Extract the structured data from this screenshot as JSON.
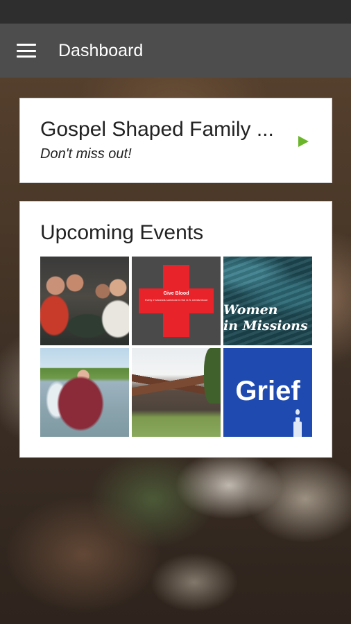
{
  "appbar": {
    "title": "Dashboard",
    "menu_icon": "hamburger-menu-icon"
  },
  "promo_card": {
    "title": "Gospel Shaped Family ...",
    "subtitle": "Don't miss out!",
    "play_icon": "play-icon",
    "play_color": "#6bb52b"
  },
  "events_card": {
    "title": "Upcoming Events",
    "tiles": [
      {
        "name": "event-tile-group-photo"
      },
      {
        "name": "event-tile-give-blood",
        "heading": "Give Blood",
        "text": "Every 2 seconds someone in the U.S. needs blood"
      },
      {
        "name": "event-tile-women-in-missions",
        "line1": "Women",
        "line2": "in Missions"
      },
      {
        "name": "event-tile-baptism"
      },
      {
        "name": "event-tile-pavilion"
      },
      {
        "name": "event-tile-grief",
        "text": "Grief"
      }
    ]
  },
  "colors": {
    "statusbar": "#2e2e2e",
    "appbar": "#4d4d4d",
    "accent_green": "#6bb52b",
    "grief_blue": "#1f4bb0",
    "blood_red": "#e8232a"
  }
}
